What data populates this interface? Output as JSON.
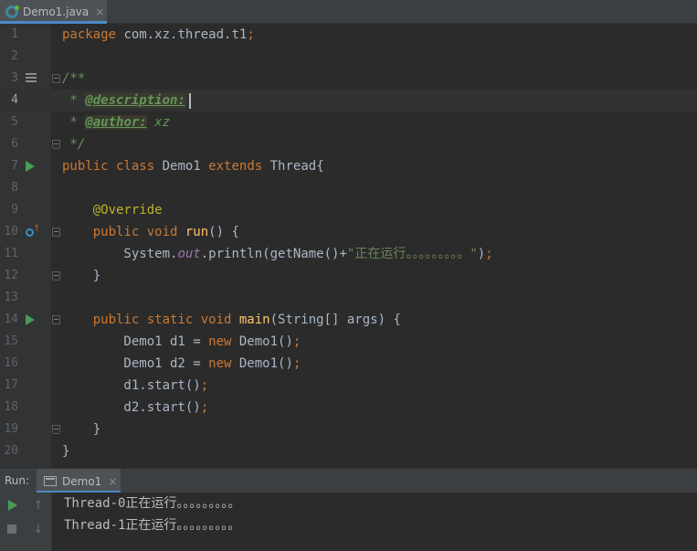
{
  "tab": {
    "filename": "Demo1.java",
    "close": "×"
  },
  "editor": {
    "line_numbers": [
      "1",
      "2",
      "3",
      "4",
      "5",
      "6",
      "7",
      "8",
      "9",
      "10",
      "11",
      "12",
      "13",
      "14",
      "15",
      "16",
      "17",
      "18",
      "19",
      "20"
    ],
    "code": {
      "l1_kw": "package",
      "l1_rest": " com.xz.thread.t1",
      "l1_semi": ";",
      "l3": "/**",
      "l4_star": " * ",
      "l4_tag": "@description:",
      "l5_star": " * ",
      "l5_tag": "@author:",
      "l5_val": " xz",
      "l6": " */",
      "l7_kw": "public class",
      "l7_name": " Demo1 ",
      "l7_kw2": "extends",
      "l7_rest": " Thread{",
      "l9": "    @Override",
      "l10_kw": "    public void ",
      "l10_fn": "run",
      "l10_rest": "() {",
      "l11_a": "        System.",
      "l11_fld": "out",
      "l11_b": ".println(getName()+",
      "l11_str": "\"正在运行。。。。。。。。。\"",
      "l11_c": ")",
      "l11_semi": ";",
      "l12": "    }",
      "l14_kw": "    public static void ",
      "l14_fn": "main",
      "l14_rest": "(String[] args) {",
      "l15_a": "        Demo1 d1 = ",
      "l15_kw": "new",
      "l15_b": " Demo1()",
      "l15_semi": ";",
      "l16_a": "        Demo1 d2 = ",
      "l16_kw": "new",
      "l16_b": " Demo1()",
      "l16_semi": ";",
      "l17_a": "        d1.start()",
      "l17_semi": ";",
      "l18_a": "        d2.start()",
      "l18_semi": ";",
      "l19": "    }",
      "l20": "}"
    }
  },
  "run_panel": {
    "title": "Run:",
    "config_tab": "Demo1",
    "close": "×",
    "up_arrow": "↑",
    "down_arrow": "↓",
    "output": [
      "Thread-0正在运行。。。。。。。。。",
      "Thread-1正在运行。。。。。。。。。"
    ]
  },
  "colors": {
    "keyword": "#cc7832",
    "doc_comment": "#629755",
    "annotation": "#bbb529",
    "method": "#ffc66d",
    "field": "#9876aa",
    "string": "#6a8759",
    "run_green": "#499c54",
    "tab_accent": "#4a88c7"
  }
}
